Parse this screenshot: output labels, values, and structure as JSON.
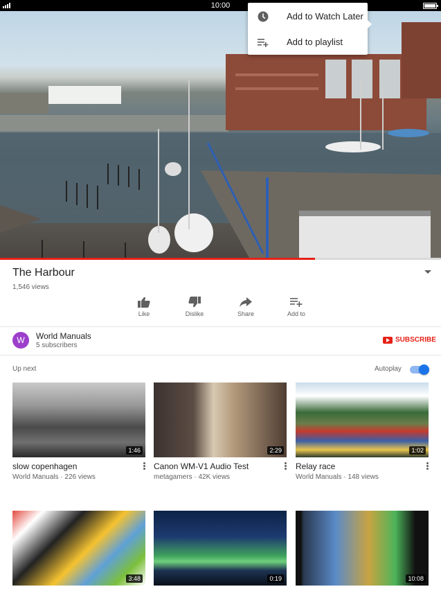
{
  "status_bar": {
    "time": "10:00"
  },
  "menu": {
    "items": [
      {
        "label": "Add to Watch Later",
        "icon": "clock-icon"
      },
      {
        "label": "Add to playlist",
        "icon": "playlist-add-icon"
      }
    ]
  },
  "video": {
    "title": "The Harbour",
    "views": "1,546 views",
    "progress": 0.715
  },
  "actions": [
    {
      "label": "Like",
      "icon": "thumb-up-icon"
    },
    {
      "label": "Dislike",
      "icon": "thumb-down-icon"
    },
    {
      "label": "Share",
      "icon": "share-icon"
    },
    {
      "label": "Add to",
      "icon": "playlist-add-icon"
    }
  ],
  "channel": {
    "initial": "W",
    "name": "World Manuals",
    "subscribers": "5 subscribers",
    "subscribe_label": "SUBSCRIBE",
    "avatar_color": "#9c3fcb"
  },
  "up_next": {
    "label": "Up next",
    "autoplay_label": "Autoplay",
    "autoplay_on": true,
    "videos": [
      {
        "title": "slow copenhagen",
        "meta": "World Manuals · 226 views",
        "duration": "1:46"
      },
      {
        "title": "Canon WM-V1 Audio Test",
        "meta": "metagamers · 42K views",
        "duration": "2:29"
      },
      {
        "title": "Relay race",
        "meta": "World Manuals · 148 views",
        "duration": "1:02"
      },
      {
        "title": "",
        "meta": "",
        "duration": "3:48"
      },
      {
        "title": "",
        "meta": "",
        "duration": "0:19"
      },
      {
        "title": "",
        "meta": "",
        "duration": "10:08"
      }
    ]
  },
  "colors": {
    "accent": "#e62117",
    "toggle": "#1a73e8"
  }
}
